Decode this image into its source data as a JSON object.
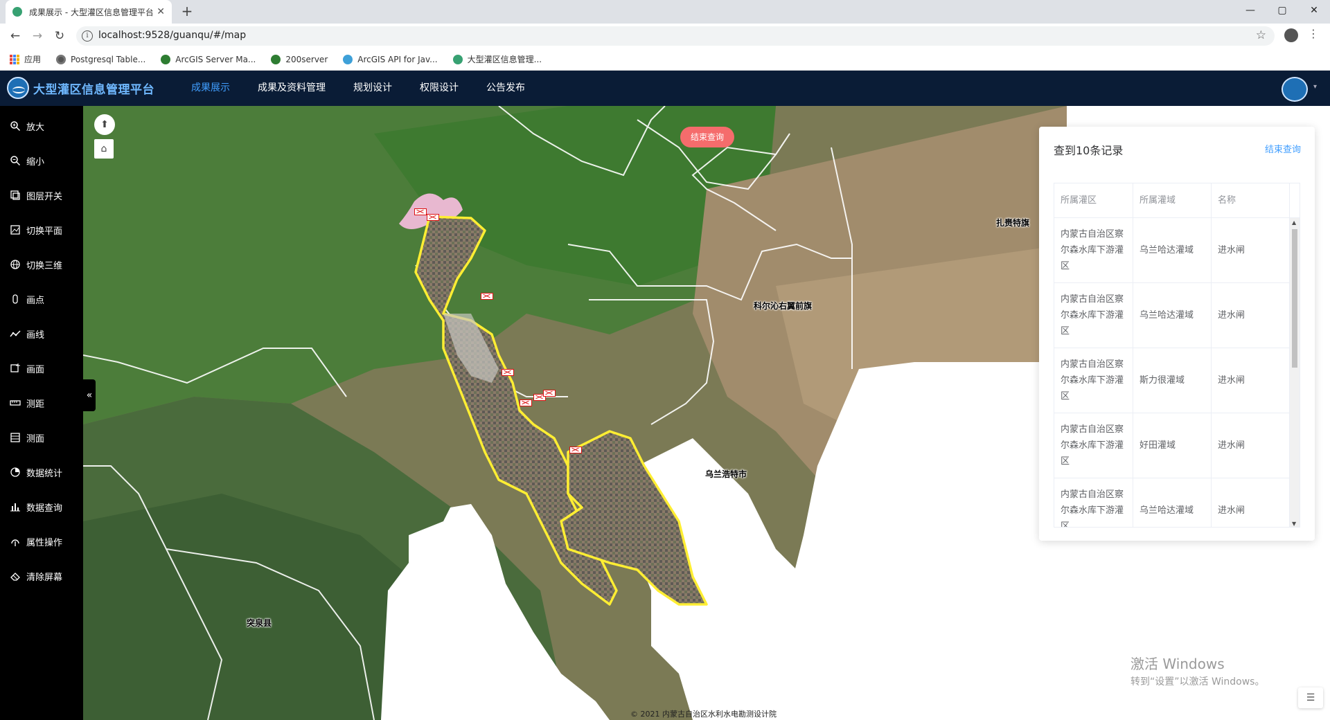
{
  "browser": {
    "tab_title": "成果展示 - 大型灌区信息管理平台",
    "tab_close": "✕",
    "new_tab": "+",
    "url": "localhost:9528/guanqu/#/map",
    "window_controls": {
      "minimize": "—",
      "maximize": "▢",
      "close": "✕"
    },
    "bookmarks": [
      {
        "label": "应用",
        "icon": "apps-icon",
        "color": "#e8453c"
      },
      {
        "label": "Postgresql Table...",
        "icon": "globe-icon",
        "color": "#555555"
      },
      {
        "label": "ArcGIS Server Ma...",
        "icon": "arcgis-icon",
        "color": "#2e7d32"
      },
      {
        "label": "200server",
        "icon": "arcgis-icon",
        "color": "#2e7d32"
      },
      {
        "label": "ArcGIS API for Jav...",
        "icon": "arcgis-api-icon",
        "color": "#3ea0d8"
      },
      {
        "label": "大型灌区信息管理...",
        "icon": "app-favicon",
        "color": "#37a172"
      }
    ]
  },
  "app": {
    "title": "大型灌区信息管理平台",
    "nav": [
      {
        "label": "成果展示",
        "active": true
      },
      {
        "label": "成果及资料管理",
        "active": false
      },
      {
        "label": "规划设计",
        "active": false
      },
      {
        "label": "权限设计",
        "active": false
      },
      {
        "label": "公告发布",
        "active": false
      }
    ],
    "accent_color": "#409eff",
    "header_bg": "#0a1c36"
  },
  "tools": [
    {
      "label": "放大",
      "icon": "zoom-in-icon"
    },
    {
      "label": "缩小",
      "icon": "zoom-out-icon"
    },
    {
      "label": "图层开关",
      "icon": "layers-icon"
    },
    {
      "label": "切换平面",
      "icon": "map-2d-icon"
    },
    {
      "label": "切换三维",
      "icon": "globe-3d-icon"
    },
    {
      "label": "画点",
      "icon": "point-icon"
    },
    {
      "label": "画线",
      "icon": "polyline-icon"
    },
    {
      "label": "画面",
      "icon": "polygon-icon"
    },
    {
      "label": "测距",
      "icon": "ruler-icon"
    },
    {
      "label": "测面",
      "icon": "area-measure-icon"
    },
    {
      "label": "数据统计",
      "icon": "statistics-icon"
    },
    {
      "label": "数据查询",
      "icon": "bar-chart-icon"
    },
    {
      "label": "属性操作",
      "icon": "attribute-icon"
    },
    {
      "label": "清除屏幕",
      "icon": "eraser-icon"
    }
  ],
  "map": {
    "end_query_pill": "结束查询",
    "collapse_glyph": "«",
    "labels": {
      "zhalaiteqi": "扎赉特旗",
      "keerqin": "科尔沁右翼前旗",
      "wulanhaote": "乌兰浩特市",
      "tuquan": "突泉县"
    },
    "copyright": "© 2021 内蒙古自治区水利水电勘测设计院",
    "irrigation_outline_color": "#ffee33"
  },
  "results": {
    "title": "查到10条记录",
    "end_query": "结束查询",
    "columns": [
      "所属灌区",
      "所属灌域",
      "名称"
    ],
    "rows": [
      {
        "district": "内蒙古自治区察尔森水库下游灌区",
        "domain": "乌兰哈达灌域",
        "name": "进水闸"
      },
      {
        "district": "内蒙古自治区察尔森水库下游灌区",
        "domain": "乌兰哈达灌域",
        "name": "进水闸"
      },
      {
        "district": "内蒙古自治区察尔森水库下游灌区",
        "domain": "斯力很灌域",
        "name": "进水闸"
      },
      {
        "district": "内蒙古自治区察尔森水库下游灌区",
        "domain": "好田灌域",
        "name": "进水闸"
      },
      {
        "district": "内蒙古自治区察尔森水库下游灌区",
        "domain": "乌兰哈达灌域",
        "name": "进水闸"
      }
    ]
  },
  "os": {
    "watermark_line1": "激活 Windows",
    "watermark_line2": "转到“设置”以激活 Windows。"
  }
}
